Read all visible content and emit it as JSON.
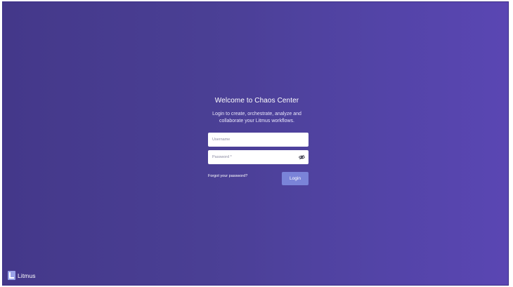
{
  "login": {
    "title": "Welcome to Chaos Center",
    "subtitle_line1": "Login to create, orchestrate, analyze and",
    "subtitle_line2": "collaborate your Litmus workflows.",
    "username_placeholder": "Username",
    "password_placeholder": "Password *",
    "forgot_password": "Forgot your password?",
    "login_button": "Login",
    "password_toggle_icon": "eye-off-icon"
  },
  "brand": {
    "name": "Litmus",
    "logo_icon": "litmus-logo-icon"
  },
  "colors": {
    "background_start": "#44388a",
    "background_end": "#5a46b3",
    "button": "#7a83d8",
    "text": "#ffffff"
  }
}
